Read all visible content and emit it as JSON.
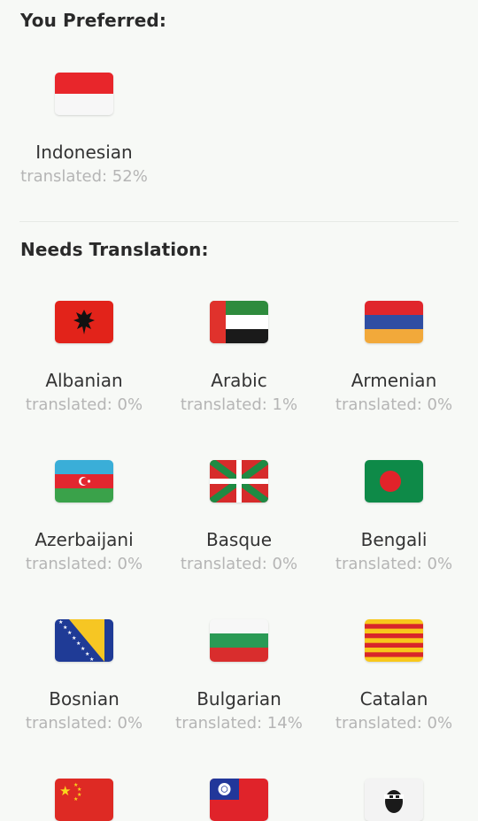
{
  "preferred_section": {
    "title": "You Preferred:",
    "languages": [
      {
        "name": "Indonesian",
        "progress": "translated: 52%",
        "flag": "indonesia-flag-icon"
      }
    ]
  },
  "needs_section": {
    "title": "Needs Translation:",
    "languages": [
      {
        "name": "Albanian",
        "progress": "translated: 0%",
        "flag": "albania-flag-icon"
      },
      {
        "name": "Arabic",
        "progress": "translated: 1%",
        "flag": "uae-flag-icon"
      },
      {
        "name": "Armenian",
        "progress": "translated: 0%",
        "flag": "armenia-flag-icon"
      },
      {
        "name": "Azerbaijani",
        "progress": "translated: 0%",
        "flag": "azerbaijan-flag-icon"
      },
      {
        "name": "Basque",
        "progress": "translated: 0%",
        "flag": "basque-flag-icon"
      },
      {
        "name": "Bengali",
        "progress": "translated: 0%",
        "flag": "bangladesh-flag-icon"
      },
      {
        "name": "Bosnian",
        "progress": "translated: 0%",
        "flag": "bosnia-flag-icon"
      },
      {
        "name": "Bulgarian",
        "progress": "translated: 14%",
        "flag": "bulgaria-flag-icon"
      },
      {
        "name": "Catalan",
        "progress": "translated: 0%",
        "flag": "catalonia-flag-icon"
      },
      {
        "flag": "china-flag-icon"
      },
      {
        "flag": "taiwan-flag-icon"
      },
      {
        "flag": "corsica-flag-icon"
      }
    ]
  },
  "colors": {
    "background": "#f7f9f6",
    "title": "#2a2a2a",
    "name": "#333333",
    "progress": "#b5b5b5"
  }
}
